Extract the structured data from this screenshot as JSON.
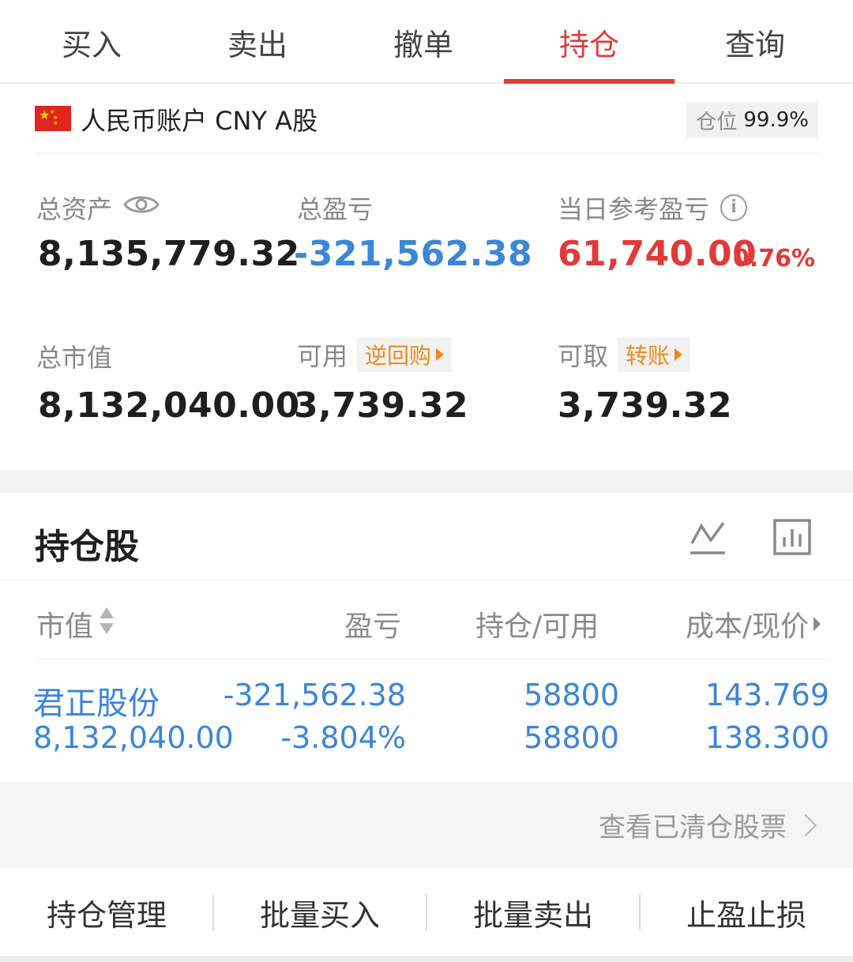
{
  "tabs": [
    {
      "label": "买入"
    },
    {
      "label": "卖出"
    },
    {
      "label": "撤单"
    },
    {
      "label": "持仓"
    },
    {
      "label": "查询"
    }
  ],
  "active_tab": "持仓",
  "account": {
    "name": "人民币账户 CNY A股",
    "position_label": "仓位",
    "position_value": "99.9%"
  },
  "summary": {
    "total_assets": {
      "label": "总资产",
      "value": "8,135,779.32"
    },
    "total_pnl": {
      "label": "总盈亏",
      "value": "-321,562.38"
    },
    "daily_pnl": {
      "label": "当日参考盈亏",
      "value": "61,740.00",
      "pct": "0.76%"
    },
    "market_value": {
      "label": "总市值",
      "value": "8,132,040.00"
    },
    "available": {
      "label": "可用",
      "action": "逆回购",
      "value": "3,739.32"
    },
    "withdrawable": {
      "label": "可取",
      "action": "转账",
      "value": "3,739.32"
    }
  },
  "holdings": {
    "title": "持仓股",
    "columns": [
      "市值",
      "盈亏",
      "持仓/可用",
      "成本/现价"
    ],
    "rows": [
      {
        "name": "君正股份",
        "market_value": "8,132,040.00",
        "pnl": "-321,562.38",
        "pnl_pct": "-3.804%",
        "position": "58800",
        "available": "58800",
        "cost": "143.769",
        "price": "138.300"
      }
    ],
    "cleared_link": "查看已清仓股票"
  },
  "bottom_actions": [
    {
      "label": "持仓管理"
    },
    {
      "label": "批量买入"
    },
    {
      "label": "批量卖出"
    },
    {
      "label": "止盈止损"
    }
  ],
  "colors": {
    "accent_red": "#e33b3b",
    "blue": "#3b86d8",
    "orange": "#f08a1c"
  }
}
